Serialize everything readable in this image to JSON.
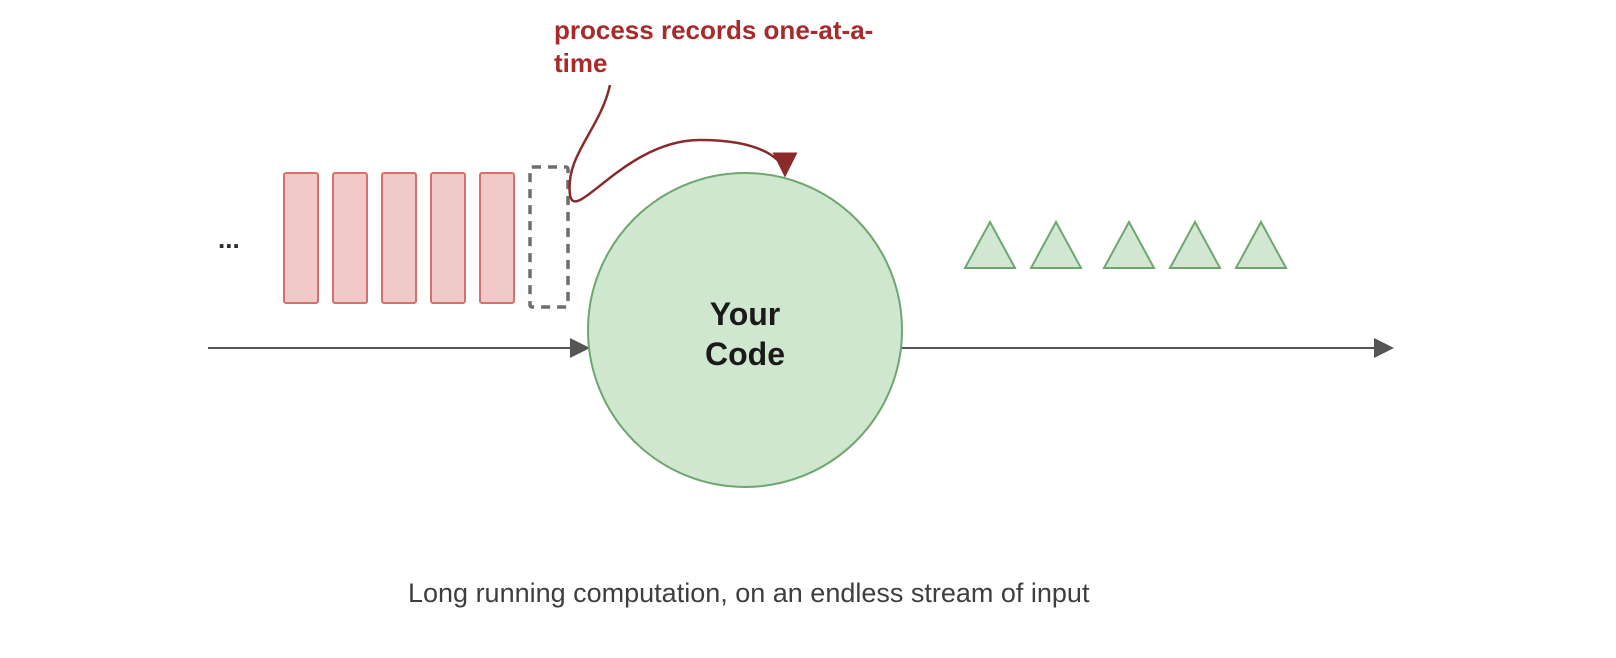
{
  "annotation": {
    "line1": "process records one-at-a-",
    "line2": "time"
  },
  "ellipsis": "...",
  "circle": {
    "line1": "Your",
    "line2": "Code"
  },
  "caption": "Long running computation, on an endless stream of input",
  "colors": {
    "record_fill": "#f2c9c9",
    "record_stroke": "#d76f6f",
    "dashed_stroke": "#6e6e6e",
    "circle_fill": "#cfe6cf",
    "circle_stroke": "#6fa66f",
    "triangle_fill": "#d1e7d1",
    "triangle_stroke": "#6fa66f",
    "axis": "#555555",
    "arrow_curve": "#8a2a2a"
  },
  "counts": {
    "input_records": 5,
    "output_triangles": 5
  }
}
